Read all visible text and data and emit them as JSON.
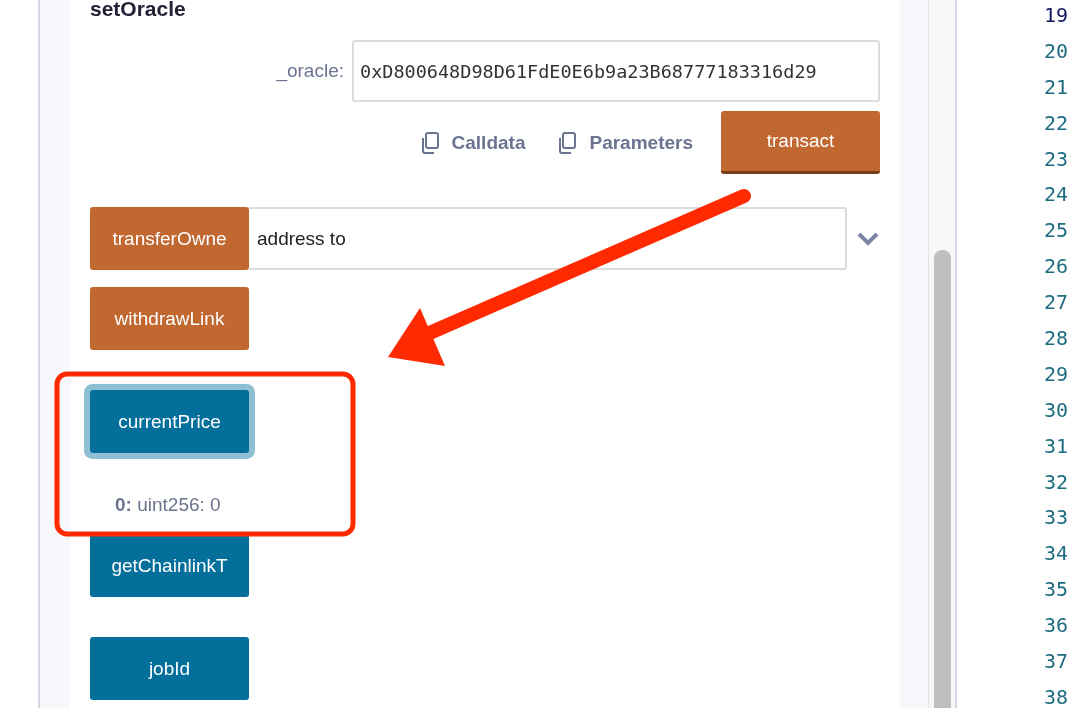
{
  "set_oracle": {
    "title": "setOracle",
    "params": [
      {
        "label": "_oracle:",
        "value": "0xD800648D98D61FdE0E6b9a23B68777183316d29"
      }
    ],
    "actions": [
      {
        "label": "Calldata"
      },
      {
        "label": "Parameters"
      }
    ],
    "submit": "transact"
  },
  "functions": [
    {
      "label": "transferOwne",
      "kind": "transact",
      "input": {
        "placeholder": "address to"
      }
    },
    {
      "label": "withdrawLink",
      "kind": "transact"
    },
    {
      "label": "currentPrice",
      "kind": "call",
      "focused": true,
      "result": "**0:** uint256: 0"
    },
    {
      "label": "getChainlinkT",
      "kind": "call",
      "focused": false
    },
    {
      "label": "jobId",
      "kind": "call",
      "focused": false
    }
  ],
  "line_numbers": [
    {
      "number": "19",
      "active": true
    },
    {
      "number": "20",
      "active": false
    },
    {
      "number": "21",
      "active": false
    },
    {
      "number": "22",
      "active": false
    },
    {
      "number": "23",
      "active": false
    },
    {
      "number": "24",
      "active": false
    },
    {
      "number": "25",
      "active": false
    },
    {
      "number": "26",
      "active": false
    },
    {
      "number": "27",
      "active": false
    },
    {
      "number": "28",
      "active": false
    },
    {
      "number": "29",
      "active": false
    },
    {
      "number": "30",
      "active": false
    },
    {
      "number": "31",
      "active": false
    },
    {
      "number": "32",
      "active": false
    },
    {
      "number": "33",
      "active": false
    },
    {
      "number": "34",
      "active": false
    },
    {
      "number": "35",
      "active": false
    },
    {
      "number": "36",
      "active": false
    },
    {
      "number": "37",
      "active": false
    },
    {
      "number": "38",
      "active": false
    }
  ]
}
